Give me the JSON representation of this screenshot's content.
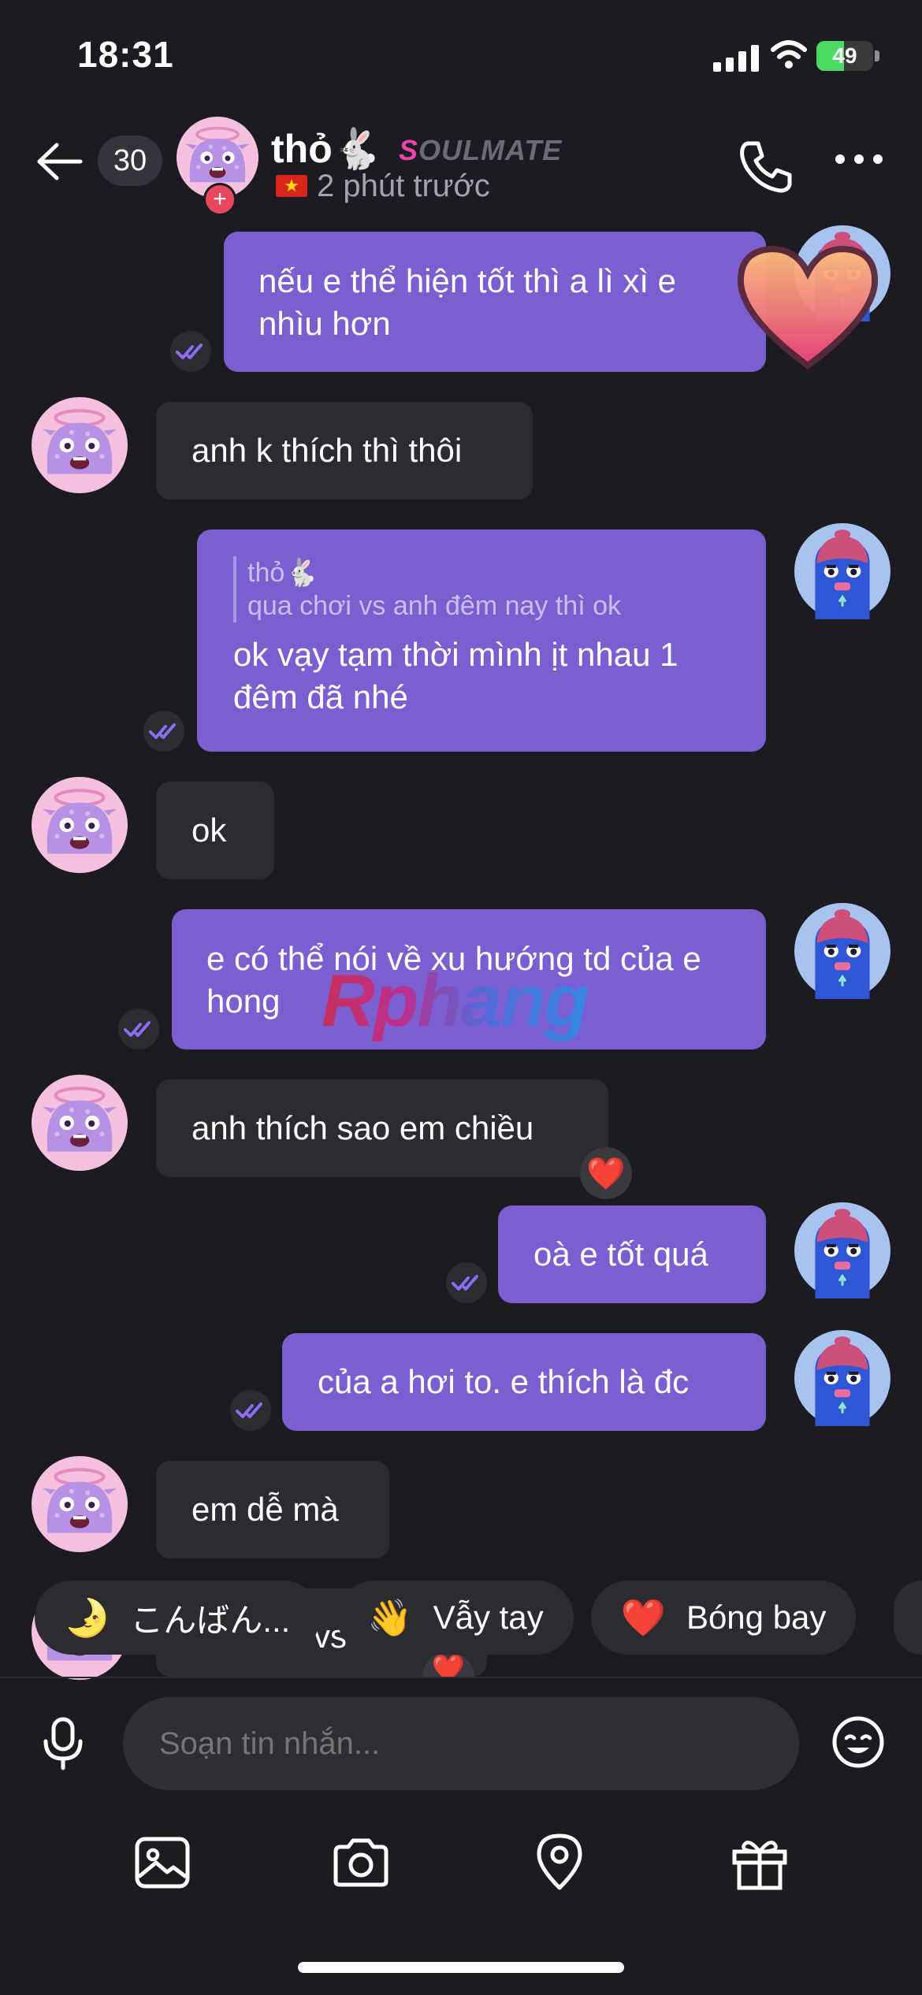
{
  "status_bar": {
    "time": "18:31",
    "battery": "49",
    "battery_level": 0.49
  },
  "header": {
    "unread_count": "30",
    "contact_name": "thỏ🐇",
    "tag_first": "S",
    "tag_rest": "OULMATE",
    "last_seen": "2 phút trước",
    "flag": "★"
  },
  "messages": [
    {
      "dir": "out",
      "text": "nếu e thể hiện tốt thì a lì xì e nhìu hơn"
    },
    {
      "dir": "in",
      "text": "anh k thích thì thôi"
    },
    {
      "dir": "out",
      "quote_name": "thỏ🐇",
      "quote_text": "qua chơi vs anh đêm nay thì ok",
      "text": "ok vạy tạm thời mình ịt nhau 1 đêm đã nhé"
    },
    {
      "dir": "in",
      "text": "ok"
    },
    {
      "dir": "out",
      "text": "e có thể nói về xu hướng td của e hong"
    },
    {
      "dir": "in",
      "text": "anh thích sao em chiều",
      "reaction": "❤️"
    },
    {
      "dir": "out",
      "text": "oà e tốt quá"
    },
    {
      "dir": "out",
      "text": "của a hơi to. e thích là đc"
    },
    {
      "dir": "in",
      "text": "em dễ mà"
    },
    {
      "dir": "in",
      "text": "vs",
      "reaction": "❤️"
    }
  ],
  "watermark": "Rphang",
  "quick_replies": [
    {
      "emoji": "🌛",
      "label": "こんばん..."
    },
    {
      "emoji": "👋",
      "label": "Vẫy tay"
    },
    {
      "emoji": "❤️",
      "label": "Bóng bay"
    }
  ],
  "composer": {
    "placeholder": "Soạn tin nhắn..."
  },
  "toolbar": [
    "image-icon",
    "camera-icon",
    "location-icon",
    "gift-icon"
  ],
  "colors": {
    "outgoing_bubble": "#7b5fd0",
    "incoming_bubble": "#2c2b31",
    "background": "#1c1b22",
    "soulmate_accent": "#e845a8"
  }
}
